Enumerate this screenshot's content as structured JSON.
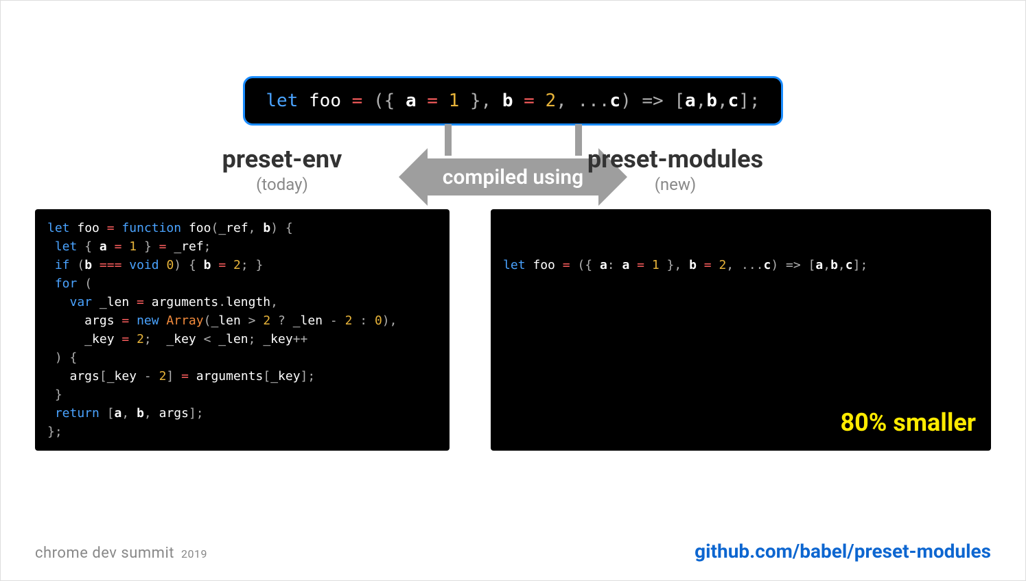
{
  "source": {
    "tokens": [
      {
        "t": "let ",
        "c": "k"
      },
      {
        "t": "foo ",
        "c": "n"
      },
      {
        "t": "= ",
        "c": "eq"
      },
      {
        "t": "(",
        "c": "p"
      },
      {
        "t": "{ ",
        "c": "p"
      },
      {
        "t": "a ",
        "c": "w"
      },
      {
        "t": "= ",
        "c": "eq"
      },
      {
        "t": "1 ",
        "c": "m"
      },
      {
        "t": "}",
        "c": "p"
      },
      {
        "t": ", ",
        "c": "p"
      },
      {
        "t": "b ",
        "c": "w"
      },
      {
        "t": "= ",
        "c": "eq"
      },
      {
        "t": "2",
        "c": "m"
      },
      {
        "t": ", ",
        "c": "p"
      },
      {
        "t": "...",
        "c": "p"
      },
      {
        "t": "c",
        "c": "w"
      },
      {
        "t": ") ",
        "c": "p"
      },
      {
        "t": "=> ",
        "c": "p"
      },
      {
        "t": "[",
        "c": "p"
      },
      {
        "t": "a",
        "c": "w"
      },
      {
        "t": ",",
        "c": "p"
      },
      {
        "t": "b",
        "c": "w"
      },
      {
        "t": ",",
        "c": "p"
      },
      {
        "t": "c",
        "c": "w"
      },
      {
        "t": "];",
        "c": "p"
      }
    ]
  },
  "arrow_label": "compiled using",
  "left_label": {
    "title": "preset-env",
    "sub": "(today)"
  },
  "right_label": {
    "title": "preset-modules",
    "sub": "(new)"
  },
  "left_panel": {
    "lines": [
      [
        {
          "t": "let ",
          "c": "k"
        },
        {
          "t": "foo ",
          "c": "n"
        },
        {
          "t": "= ",
          "c": "eq"
        },
        {
          "t": "function ",
          "c": "k"
        },
        {
          "t": "foo",
          "c": "n"
        },
        {
          "t": "(",
          "c": "p"
        },
        {
          "t": "_ref",
          "c": "n"
        },
        {
          "t": ", ",
          "c": "p"
        },
        {
          "t": "b",
          "c": "w"
        },
        {
          "t": ") {",
          "c": "p"
        }
      ],
      [
        {
          "t": " let ",
          "c": "k"
        },
        {
          "t": "{ ",
          "c": "p"
        },
        {
          "t": "a ",
          "c": "w"
        },
        {
          "t": "= ",
          "c": "eq"
        },
        {
          "t": "1 ",
          "c": "m"
        },
        {
          "t": "} ",
          "c": "p"
        },
        {
          "t": "= ",
          "c": "eq"
        },
        {
          "t": "_ref",
          "c": "n"
        },
        {
          "t": ";",
          "c": "p"
        }
      ],
      [
        {
          "t": " if ",
          "c": "k"
        },
        {
          "t": "(",
          "c": "p"
        },
        {
          "t": "b ",
          "c": "w"
        },
        {
          "t": "=== ",
          "c": "eq"
        },
        {
          "t": "void ",
          "c": "k"
        },
        {
          "t": "0",
          "c": "m"
        },
        {
          "t": ") { ",
          "c": "p"
        },
        {
          "t": "b ",
          "c": "w"
        },
        {
          "t": "= ",
          "c": "eq"
        },
        {
          "t": "2",
          "c": "m"
        },
        {
          "t": "; }",
          "c": "p"
        }
      ],
      [
        {
          "t": " for ",
          "c": "k"
        },
        {
          "t": "(",
          "c": "p"
        }
      ],
      [
        {
          "t": "   var ",
          "c": "k"
        },
        {
          "t": "_len ",
          "c": "n"
        },
        {
          "t": "= ",
          "c": "eq"
        },
        {
          "t": "arguments",
          "c": "n"
        },
        {
          "t": ".",
          "c": "p"
        },
        {
          "t": "length",
          "c": "n"
        },
        {
          "t": ",",
          "c": "p"
        }
      ],
      [
        {
          "t": "     args ",
          "c": "n"
        },
        {
          "t": "= ",
          "c": "eq"
        },
        {
          "t": "new ",
          "c": "k"
        },
        {
          "t": "Array",
          "c": "c"
        },
        {
          "t": "(",
          "c": "p"
        },
        {
          "t": "_len ",
          "c": "n"
        },
        {
          "t": "> ",
          "c": "o"
        },
        {
          "t": "2 ",
          "c": "m"
        },
        {
          "t": "? ",
          "c": "o"
        },
        {
          "t": "_len ",
          "c": "n"
        },
        {
          "t": "- ",
          "c": "o"
        },
        {
          "t": "2 ",
          "c": "m"
        },
        {
          "t": ": ",
          "c": "o"
        },
        {
          "t": "0",
          "c": "m"
        },
        {
          "t": "),",
          "c": "p"
        }
      ],
      [
        {
          "t": "     _key ",
          "c": "n"
        },
        {
          "t": "= ",
          "c": "eq"
        },
        {
          "t": "2",
          "c": "m"
        },
        {
          "t": ";  ",
          "c": "p"
        },
        {
          "t": "_key ",
          "c": "n"
        },
        {
          "t": "< ",
          "c": "o"
        },
        {
          "t": "_len",
          "c": "n"
        },
        {
          "t": "; ",
          "c": "p"
        },
        {
          "t": "_key",
          "c": "n"
        },
        {
          "t": "++",
          "c": "o"
        }
      ],
      [
        {
          "t": " ) {",
          "c": "p"
        }
      ],
      [
        {
          "t": "   args",
          "c": "n"
        },
        {
          "t": "[",
          "c": "p"
        },
        {
          "t": "_key ",
          "c": "n"
        },
        {
          "t": "- ",
          "c": "o"
        },
        {
          "t": "2",
          "c": "m"
        },
        {
          "t": "] ",
          "c": "p"
        },
        {
          "t": "= ",
          "c": "eq"
        },
        {
          "t": "arguments",
          "c": "n"
        },
        {
          "t": "[",
          "c": "p"
        },
        {
          "t": "_key",
          "c": "n"
        },
        {
          "t": "];",
          "c": "p"
        }
      ],
      [
        {
          "t": " }",
          "c": "p"
        }
      ],
      [
        {
          "t": " return ",
          "c": "k"
        },
        {
          "t": "[",
          "c": "p"
        },
        {
          "t": "a",
          "c": "w"
        },
        {
          "t": ", ",
          "c": "p"
        },
        {
          "t": "b",
          "c": "w"
        },
        {
          "t": ", ",
          "c": "p"
        },
        {
          "t": "args",
          "c": "n"
        },
        {
          "t": "];",
          "c": "p"
        }
      ],
      [
        {
          "t": "};",
          "c": "p"
        }
      ]
    ]
  },
  "right_panel": {
    "lines": [
      [
        {
          "t": "let ",
          "c": "k"
        },
        {
          "t": "foo ",
          "c": "n"
        },
        {
          "t": "= ",
          "c": "eq"
        },
        {
          "t": "(",
          "c": "p"
        },
        {
          "t": "{ ",
          "c": "p"
        },
        {
          "t": "a",
          "c": "w"
        },
        {
          "t": ": ",
          "c": "p"
        },
        {
          "t": "a ",
          "c": "w"
        },
        {
          "t": "= ",
          "c": "eq"
        },
        {
          "t": "1 ",
          "c": "m"
        },
        {
          "t": "}",
          "c": "p"
        },
        {
          "t": ", ",
          "c": "p"
        },
        {
          "t": "b ",
          "c": "w"
        },
        {
          "t": "= ",
          "c": "eq"
        },
        {
          "t": "2",
          "c": "m"
        },
        {
          "t": ", ",
          "c": "p"
        },
        {
          "t": "...",
          "c": "p"
        },
        {
          "t": "c",
          "c": "w"
        },
        {
          "t": ") ",
          "c": "p"
        },
        {
          "t": "=> ",
          "c": "p"
        },
        {
          "t": "[",
          "c": "p"
        },
        {
          "t": "a",
          "c": "w"
        },
        {
          "t": ",",
          "c": "p"
        },
        {
          "t": "b",
          "c": "w"
        },
        {
          "t": ",",
          "c": "p"
        },
        {
          "t": "c",
          "c": "w"
        },
        {
          "t": "];",
          "c": "p"
        }
      ]
    ],
    "badge": "80% smaller"
  },
  "footer": {
    "event": "chrome dev summit",
    "year": "2019",
    "link": "github.com/babel/preset-modules"
  }
}
